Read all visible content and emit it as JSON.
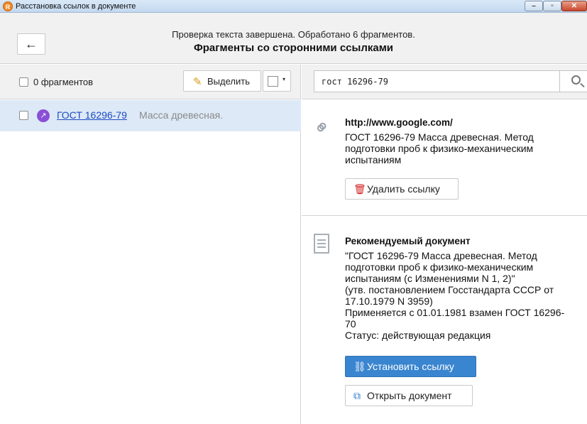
{
  "window": {
    "title": "Расстановка ссылок в документе",
    "app_icon": "R",
    "min_glyph": "–",
    "max_glyph": "▫",
    "close_glyph": "✕"
  },
  "header": {
    "back_glyph": "←",
    "status": "Проверка текста завершена. Обработано 6 фрагментов.",
    "title": "Фрагменты со сторонними ссылками"
  },
  "left_toolbar": {
    "count_label": "0 фрагментов",
    "select_label": "Выделить",
    "select_icon": "pencil-icon",
    "dropdown_caret": "▾"
  },
  "fragments": [
    {
      "link": "ГОСТ 16296-79",
      "text": "Масса древесная.",
      "icon_glyph": "↗"
    }
  ],
  "search": {
    "value": "гост 16296-79",
    "placeholder": ""
  },
  "card_link": {
    "url": "http://www.google.com/",
    "text": "ГОСТ 16296-79 Масса древесная. Метод подготовки проб к физико-механическим испытаниям",
    "delete_label": "Удалить ссылку",
    "delete_icon_glyph": "🗑"
  },
  "card_recommended": {
    "title": "Рекомендуемый документ",
    "lines": [
      "\"ГОСТ 16296-79 Масса древесная. Метод подготовки проб к физико-механическим испытаниям (с Изменениями N 1, 2)\"",
      "(утв. постановлением Госстандарта СССР от 17.10.1979 N 3959)",
      "Применяется с 01.01.1981 взамен ГОСТ 16296-70",
      "Статус: действующая редакция"
    ],
    "set_link_label": "Установить ссылку",
    "set_link_glyph": "⛓",
    "open_doc_label": "Открыть документ",
    "open_doc_glyph": "⧉"
  },
  "colors": {
    "accent": "#3a85d0",
    "selection": "#dde9f6",
    "link": "#1d4bc4",
    "delete_icon": "#d21f1f",
    "open_icon": "#2d7fd1"
  }
}
